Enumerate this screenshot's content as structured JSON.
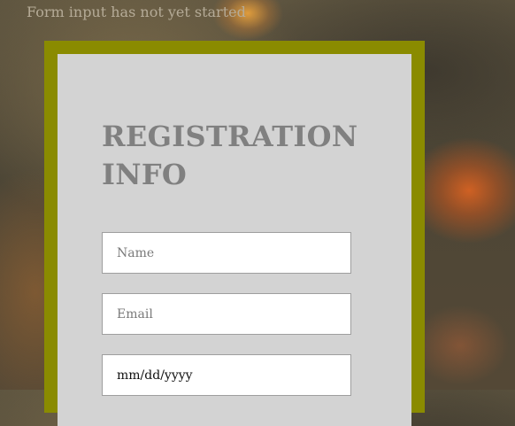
{
  "status": {
    "text": "Form input has not yet started"
  },
  "form": {
    "title": "REGISTRATION INFO",
    "fields": {
      "name": {
        "placeholder": "Name",
        "value": ""
      },
      "email": {
        "placeholder": "Email",
        "value": ""
      },
      "date": {
        "display": "mm/dd/yyyy",
        "value": ""
      }
    }
  },
  "colors": {
    "frame_border": "#8a8b00",
    "card_background": "#d3d3d3",
    "title_text": "#808080",
    "status_text": "#b5ab97"
  }
}
